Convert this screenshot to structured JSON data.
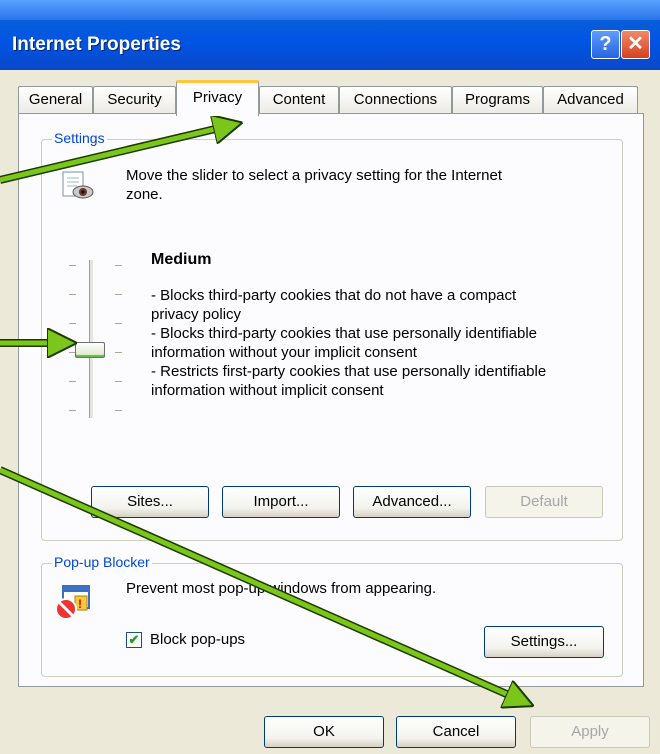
{
  "window": {
    "title": "Internet Properties",
    "help_glyph": "?",
    "close_glyph": "✕"
  },
  "tabs": [
    {
      "label": "General"
    },
    {
      "label": "Security"
    },
    {
      "label": "Privacy",
      "active": true
    },
    {
      "label": "Content"
    },
    {
      "label": "Connections"
    },
    {
      "label": "Programs"
    },
    {
      "label": "Advanced"
    }
  ],
  "settings": {
    "group_label": "Settings",
    "intro": [
      "Move the slider to select a privacy setting for the Internet",
      "zone."
    ],
    "level_title": "Medium",
    "description_lines": [
      "- Blocks third-party cookies that do not have a compact",
      "privacy policy",
      "- Blocks third-party cookies that use personally identifiable",
      "information without your implicit consent",
      "- Restricts first-party cookies that use personally identifiable",
      "information without implicit consent"
    ],
    "slider": {
      "levels": 6,
      "selected_level": 4
    },
    "buttons": {
      "sites": "Sites...",
      "import": "Import...",
      "advanced": "Advanced...",
      "default": "Default"
    }
  },
  "popup": {
    "group_label": "Pop-up Blocker",
    "description": "Prevent most pop-up windows from appearing.",
    "checkbox_label": "Block pop-ups",
    "checkbox_checked": true,
    "settings_button": "Settings..."
  },
  "footer": {
    "ok": "OK",
    "cancel": "Cancel",
    "apply": "Apply"
  },
  "annotations": {
    "arrow_color": "#7cc51a"
  }
}
